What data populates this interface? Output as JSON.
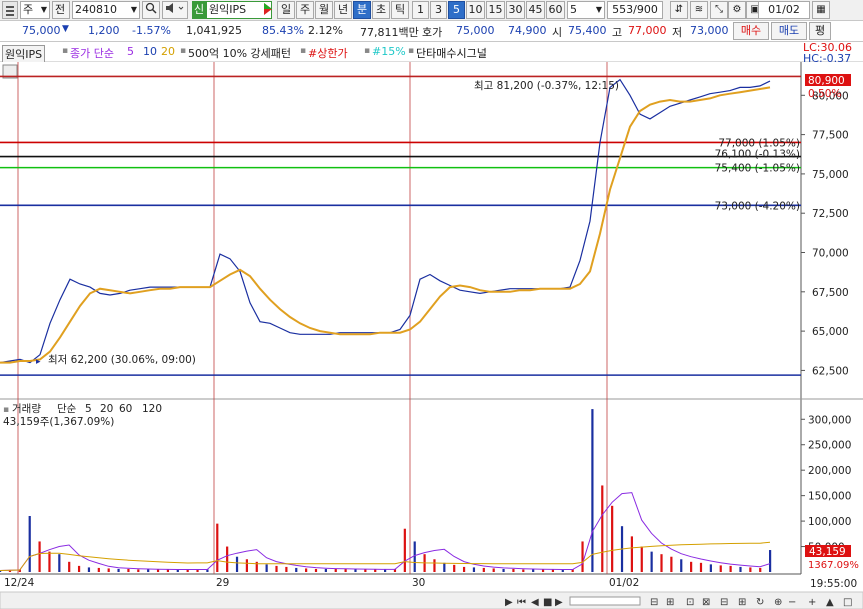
{
  "toolbar": {
    "market_type": "주",
    "exchange_flag": "전",
    "stock_code": "240810",
    "sin_badge": "신",
    "stock_name": "원익IPS",
    "periods": [
      "일",
      "주",
      "월",
      "년",
      "분",
      "초",
      "틱"
    ],
    "selected_period": "분",
    "intervals": [
      "1",
      "3",
      "5",
      "10",
      "15",
      "30",
      "45",
      "60"
    ],
    "selected_interval": "5",
    "interval_value": "5",
    "count": "553/900",
    "date": "01/02"
  },
  "quote": {
    "price": "75,000",
    "down_arrow": "▼",
    "change": "1,200",
    "change_pct": "-1.57%",
    "volume": "1,041,925",
    "ratio": "85.43%",
    "turnover": "2.12%",
    "amount": "77,811백만",
    "hoga_label": "호가",
    "ask": "75,000",
    "bid": "74,900",
    "open_label": "시",
    "open": "75,400",
    "high_label": "고",
    "high": "77,000",
    "low_label": "저",
    "low": "73,000",
    "buy_button": "매수",
    "sell_button": "매도",
    "eval_button": "평"
  },
  "legend": {
    "name": "원익IPS",
    "ma_label": "종가 단순",
    "ma5": "5",
    "ma10": "10",
    "ma20": "20",
    "signal1": "500억 10% 강세패턴",
    "signal2": "#상한가",
    "signal3": "#15%",
    "signal4": "단타매수시그널"
  },
  "price_panel": {
    "lc": "LC:30.06",
    "hc": "HC:-0.37",
    "current_price_tag": "80,900",
    "current_pct_tag": "0.50%",
    "high_annotation": "최고 81,200 (-0.37%, 12:15)",
    "low_annotation": "최저 62,200 (30.06%, 09:00)",
    "line_labels": [
      {
        "text": "77,000 (1.05%)",
        "color": "#d11"
      },
      {
        "text": "76,100 (-0.13%)",
        "color": "#111"
      },
      {
        "text": "75,400 (-1.05%)",
        "color": "#14c814"
      },
      {
        "text": "73,000 (-4.20%)",
        "color": "#1a2fa0"
      }
    ]
  },
  "volume_panel": {
    "title": "거래량",
    "ma_label": "단순",
    "ma5": "5",
    "ma20": "20",
    "ma60": "60",
    "ma120": "120",
    "current": "43,159주(1,367.09%)",
    "tag_value": "43,159",
    "tag_pct": "1367.09%"
  },
  "time_footer": "19:55:00",
  "chart_data": {
    "type": "line",
    "x_labels": [
      "12/24",
      "29",
      "30",
      "01/02"
    ],
    "price_axis": [
      "80,000",
      "77,500",
      "75,000",
      "72,500",
      "70,000",
      "67,500",
      "65,000",
      "62,500"
    ],
    "volume_axis": [
      "300,000",
      "250,000",
      "200,000",
      "150,000",
      "100,000",
      "50,000"
    ],
    "ylim": [
      61000,
      81800
    ],
    "volume_ylim": [
      0,
      330000
    ],
    "horizontal_lines": [
      {
        "value": 81200,
        "color": "#b22"
      },
      {
        "value": 77000,
        "color": "#c00"
      },
      {
        "value": 76100,
        "color": "#111"
      },
      {
        "value": 75400,
        "color": "#10c010"
      },
      {
        "value": 73000,
        "color": "#1a2fa0"
      },
      {
        "value": 62200,
        "color": "#1a2fa0"
      }
    ],
    "series": [
      {
        "name": "종가",
        "color": "#1a2fa0",
        "values": [
          63000,
          63100,
          63200,
          63000,
          63500,
          65500,
          67000,
          68300,
          68000,
          67800,
          67400,
          67300,
          67400,
          67600,
          67700,
          67800,
          67800,
          67800,
          67800,
          67800,
          67800,
          67800,
          69900,
          69600,
          68800,
          66800,
          65600,
          65500,
          65200,
          64900,
          64800,
          64800,
          64800,
          64800,
          64900,
          64900,
          64900,
          64900,
          64900,
          64900,
          65100,
          66000,
          68300,
          68600,
          68200,
          67900,
          67600,
          67500,
          67400,
          67500,
          67600,
          67700,
          67700,
          67700,
          67700,
          67700,
          67700,
          67800,
          69500,
          72000,
          77000,
          80500,
          81000,
          80000,
          78800,
          78500,
          78900,
          79300,
          79500,
          79700,
          79900,
          80100,
          80200,
          80300,
          80500,
          80500,
          80600,
          80900
        ]
      },
      {
        "name": "5",
        "color": "#e0a020",
        "values": [
          63000,
          63000,
          63100,
          63100,
          63200,
          63700,
          64600,
          65600,
          66600,
          67400,
          67700,
          67600,
          67500,
          67400,
          67500,
          67600,
          67700,
          67700,
          67800,
          67800,
          67800,
          67800,
          68200,
          68600,
          68900,
          68500,
          67700,
          67000,
          66400,
          65900,
          65500,
          65200,
          65000,
          64900,
          64800,
          64800,
          64800,
          64800,
          64900,
          64900,
          64900,
          65100,
          65600,
          66400,
          67200,
          67800,
          67900,
          67800,
          67600,
          67500,
          67500,
          67500,
          67600,
          67600,
          67700,
          67700,
          67700,
          67700,
          68000,
          68800,
          71200,
          74000,
          76000,
          78000,
          79000,
          79400,
          79600,
          79700,
          79600,
          79600,
          79700,
          79800,
          80000,
          80100,
          80200,
          80300,
          80400,
          80500
        ]
      }
    ],
    "volume_values": [
      3000,
      4000,
      5000,
      110000,
      60000,
      40000,
      35000,
      20000,
      12000,
      9000,
      8000,
      7000,
      6000,
      6000,
      5000,
      5000,
      5000,
      5000,
      5000,
      5000,
      5000,
      5000,
      95000,
      50000,
      30000,
      25000,
      20000,
      15000,
      12000,
      10000,
      8000,
      7000,
      6000,
      6000,
      6000,
      6000,
      5000,
      5000,
      5000,
      5000,
      6000,
      85000,
      60000,
      35000,
      25000,
      18000,
      14000,
      10000,
      9000,
      8000,
      7000,
      6000,
      6000,
      5000,
      5000,
      5000,
      5000,
      5000,
      5000,
      60000,
      320000,
      170000,
      130000,
      90000,
      70000,
      50000,
      40000,
      35000,
      30000,
      25000,
      20000,
      18000,
      15000,
      13000,
      12000,
      10000,
      9000,
      8000,
      43159
    ],
    "volume_ma": [
      {
        "name": "5",
        "color": "#8a2be2"
      },
      {
        "name": "20",
        "color": "#d4a000"
      },
      {
        "name": "60",
        "color": "#2a8a2a"
      },
      {
        "name": "120",
        "color": "#888888"
      }
    ]
  }
}
